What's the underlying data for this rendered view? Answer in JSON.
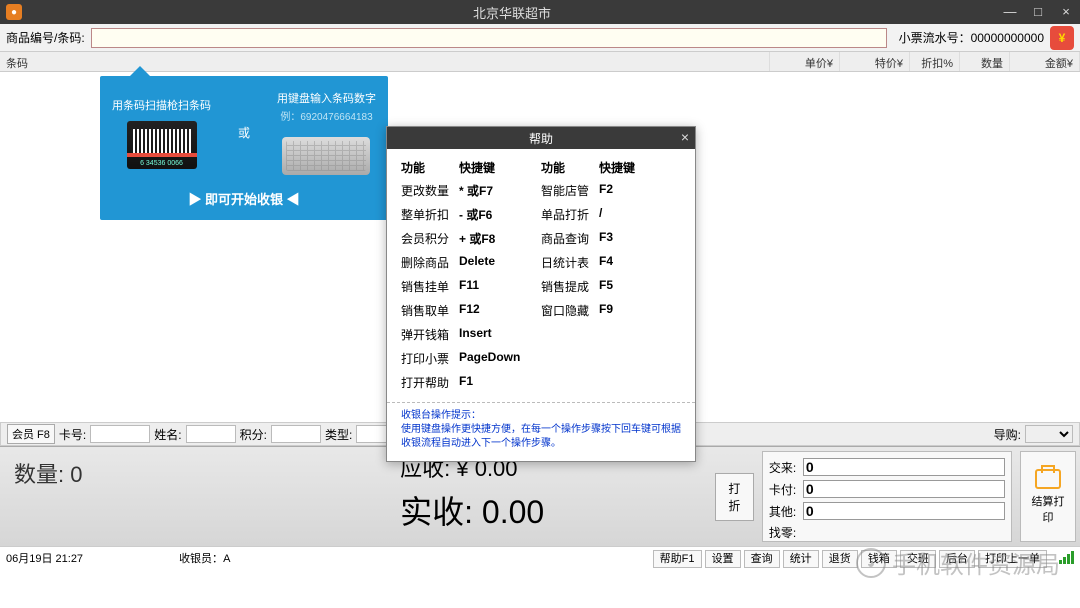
{
  "window": {
    "title": "北京华联超市",
    "min": "—",
    "max": "□",
    "close": "×"
  },
  "topbar": {
    "barcode_label": "商品编号/条码:",
    "serial_label": "小票流水号：",
    "serial_value": "00000000000",
    "coin": "¥"
  },
  "table": {
    "barcode": "条码",
    "price": "单价¥",
    "special": "特价¥",
    "disc": "折扣%",
    "qty": "数量",
    "amt": "金额¥"
  },
  "tip": {
    "scan_text": "用条码扫描枪扫条码",
    "or": "或",
    "kb_text": "用键盘输入条码数字",
    "example": "例：6920476664183",
    "barcode_num": "6 34536 0066",
    "start": "▶ 即可开始收银 ◀"
  },
  "help": {
    "title": "帮助",
    "h_fn": "功能",
    "h_key": "快捷键",
    "left": [
      {
        "fn": "更改数量",
        "key": "* 或F7"
      },
      {
        "fn": "整单折扣",
        "key": "- 或F6"
      },
      {
        "fn": "会员积分",
        "key": "+ 或F8"
      },
      {
        "fn": "删除商品",
        "key": "Delete"
      },
      {
        "fn": "销售挂单",
        "key": "F11"
      },
      {
        "fn": "销售取单",
        "key": "F12"
      },
      {
        "fn": "弹开钱箱",
        "key": "Insert"
      },
      {
        "fn": "打印小票",
        "key": "PageDown"
      },
      {
        "fn": "打开帮助",
        "key": "F1"
      }
    ],
    "right": [
      {
        "fn": "智能店管",
        "key": "F2"
      },
      {
        "fn": "单品打折",
        "key": "/"
      },
      {
        "fn": "商品查询",
        "key": "F3"
      },
      {
        "fn": "日统计表",
        "key": "F4"
      },
      {
        "fn": "销售提成",
        "key": "F5"
      },
      {
        "fn": "窗口隐藏",
        "key": "F9"
      }
    ],
    "hint_title": "收银台操作提示：",
    "hint_body": "使用键盘操作更快捷方便，在每一个操作步骤按下回车键可根据收银流程自动进入下一个操作步骤。"
  },
  "member": {
    "btn": "会员 F8",
    "card": "卡号:",
    "name": "姓名:",
    "points": "积分:",
    "type": "类型:",
    "guide": "导购:"
  },
  "totals": {
    "qty_label": "数量:",
    "qty_value": "0",
    "due_label": "应收:",
    "due_value": "¥ 0.00",
    "paid_label": "实收:",
    "paid_value": "0.00",
    "disc_btn": "打折",
    "cash": "交来:",
    "cash_v": "0",
    "card": "卡付:",
    "card_v": "0",
    "other": "其他:",
    "other_v": "0",
    "change": "找零:",
    "print": "结算打印"
  },
  "status": {
    "date": "06月19日 21:27",
    "cashier_label": "收银员：",
    "cashier_value": "A",
    "buttons": [
      "帮助F1",
      "设置",
      "查询",
      "统计",
      "退货",
      "钱箱",
      "交班",
      "后台",
      "打印上一单"
    ]
  },
  "watermark": "手机软件资源局"
}
